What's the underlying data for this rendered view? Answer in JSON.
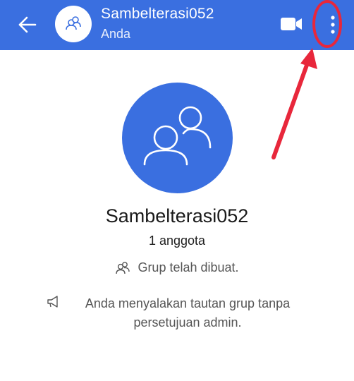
{
  "header": {
    "title": "Sambelterasi052",
    "subtitle": "Anda",
    "back_icon": "arrow-left-icon",
    "avatar_icon": "group-icon",
    "video_icon": "video-call-icon",
    "menu_icon": "more-vertical-icon",
    "background_color": "#3a6fe0"
  },
  "annotation": {
    "highlight_color": "#e8273b"
  },
  "profile": {
    "group_name": "Sambelterasi052",
    "member_count": "1 anggota",
    "avatar_color": "#3a6fe0"
  },
  "system_messages": [
    {
      "icon": "group-icon",
      "text": "Grup telah dibuat."
    },
    {
      "icon": "megaphone-icon",
      "line1": "Anda menyalakan tautan grup tanpa",
      "line2": "persetujuan admin."
    }
  ]
}
